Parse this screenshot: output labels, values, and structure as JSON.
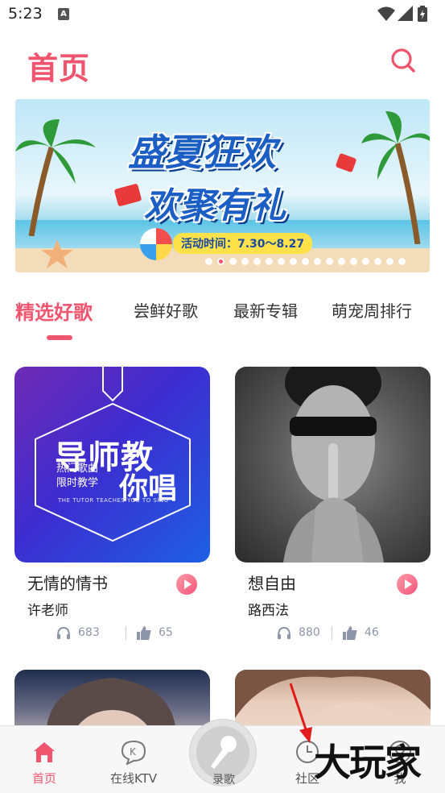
{
  "status_bar": {
    "time": "5:23",
    "notification_badge": "A"
  },
  "header": {
    "title": "首页",
    "search_icon": "search-icon"
  },
  "banner": {
    "title_line1": "盛夏狂欢",
    "title_line2": "欢聚有礼",
    "date_text": "活动时间：7.30～8.27",
    "slide_count": 17,
    "active_slide": 2
  },
  "tabs": [
    {
      "label": "精选好歌",
      "active": true
    },
    {
      "label": "尝鲜好歌",
      "active": false
    },
    {
      "label": "最新专辑",
      "active": false
    },
    {
      "label": "萌宠周排行",
      "active": false
    }
  ],
  "cards": [
    {
      "title": "无情的情书",
      "artist": "许老师",
      "listens": "683",
      "likes": "65",
      "cover_text": {
        "line1": "导师教",
        "line2a": "热门歌曲",
        "line2b": "限时教学",
        "line3": "你唱",
        "tagline": "THE TUTOR TEACHES YOU TO SING"
      }
    },
    {
      "title": "想自由",
      "artist": "路西法",
      "listens": "880",
      "likes": "46"
    }
  ],
  "bottom_nav": {
    "home": "首页",
    "ktv": "在线KTV",
    "ktv_icon_letter": "K",
    "record": "录歌",
    "community": "社区",
    "me": "我"
  },
  "watermark": "大玩家",
  "colors": {
    "accent": "#f0556f",
    "muted": "#8c96a8"
  }
}
